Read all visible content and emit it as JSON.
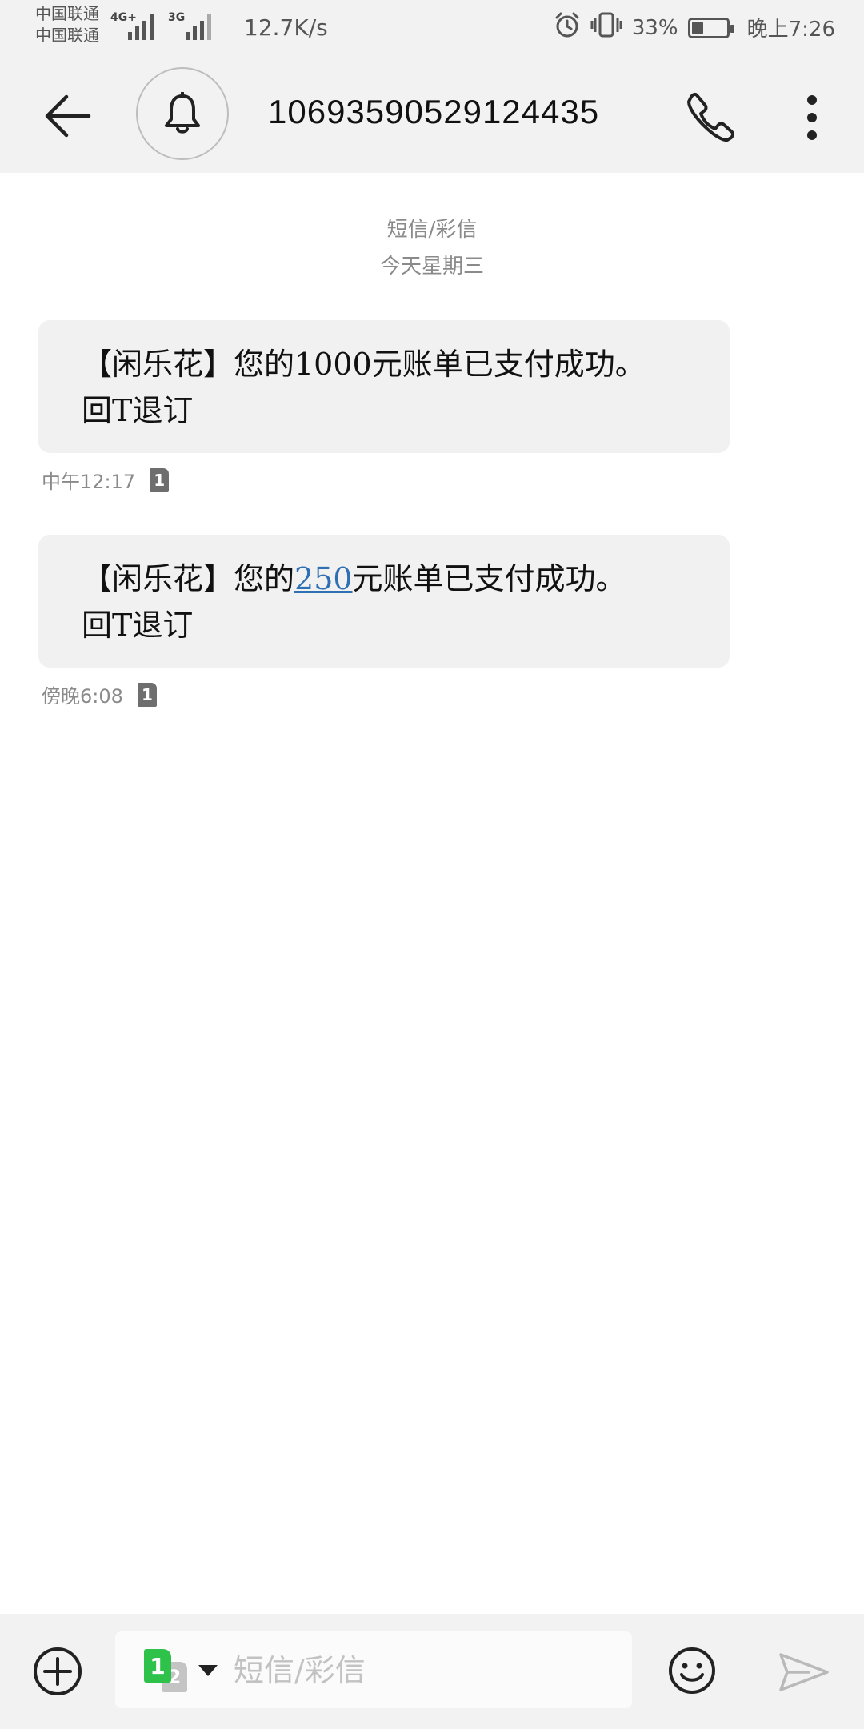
{
  "status_bar": {
    "carrier_1": "中国联通",
    "carrier_2": "中国联通",
    "net_1": "4G+",
    "net_2": "3G",
    "speed": "12.7K/s",
    "battery_percent": "33%",
    "battery_level": 0.33,
    "time": "晚上7:26",
    "icons": [
      "signal-icon",
      "alarm-icon",
      "vibrate-icon",
      "battery-icon"
    ]
  },
  "header": {
    "title": "10693590529124435",
    "icons": [
      "back-arrow-icon",
      "bell-icon",
      "phone-icon",
      "more-vert-icon"
    ]
  },
  "thread": {
    "type_label": "短信/彩信",
    "date_label": "今天星期三"
  },
  "messages": [
    {
      "line1_text": "【闲乐花】您的1000元账单已支付成功。",
      "line2_text": "回T退订",
      "time": "中午12:17",
      "sim": "1"
    },
    {
      "line1_pre": "【闲乐花】您的",
      "line1_amount": "250",
      "line1_post": "元账单已支付成功。",
      "line2_text": "回T退订",
      "time": "傍晚6:08",
      "sim": "1"
    }
  ],
  "composer": {
    "placeholder": "短信/彩信",
    "sim_1": "1",
    "sim_2": "2",
    "icons": [
      "add-circle-icon",
      "emoji-icon",
      "send-icon"
    ]
  },
  "colors": {
    "bar_background": "#f2f2f2",
    "bubble_background": "#f1f1f1",
    "link": "#2f6fb4",
    "sim_active": "#2ec24a"
  }
}
